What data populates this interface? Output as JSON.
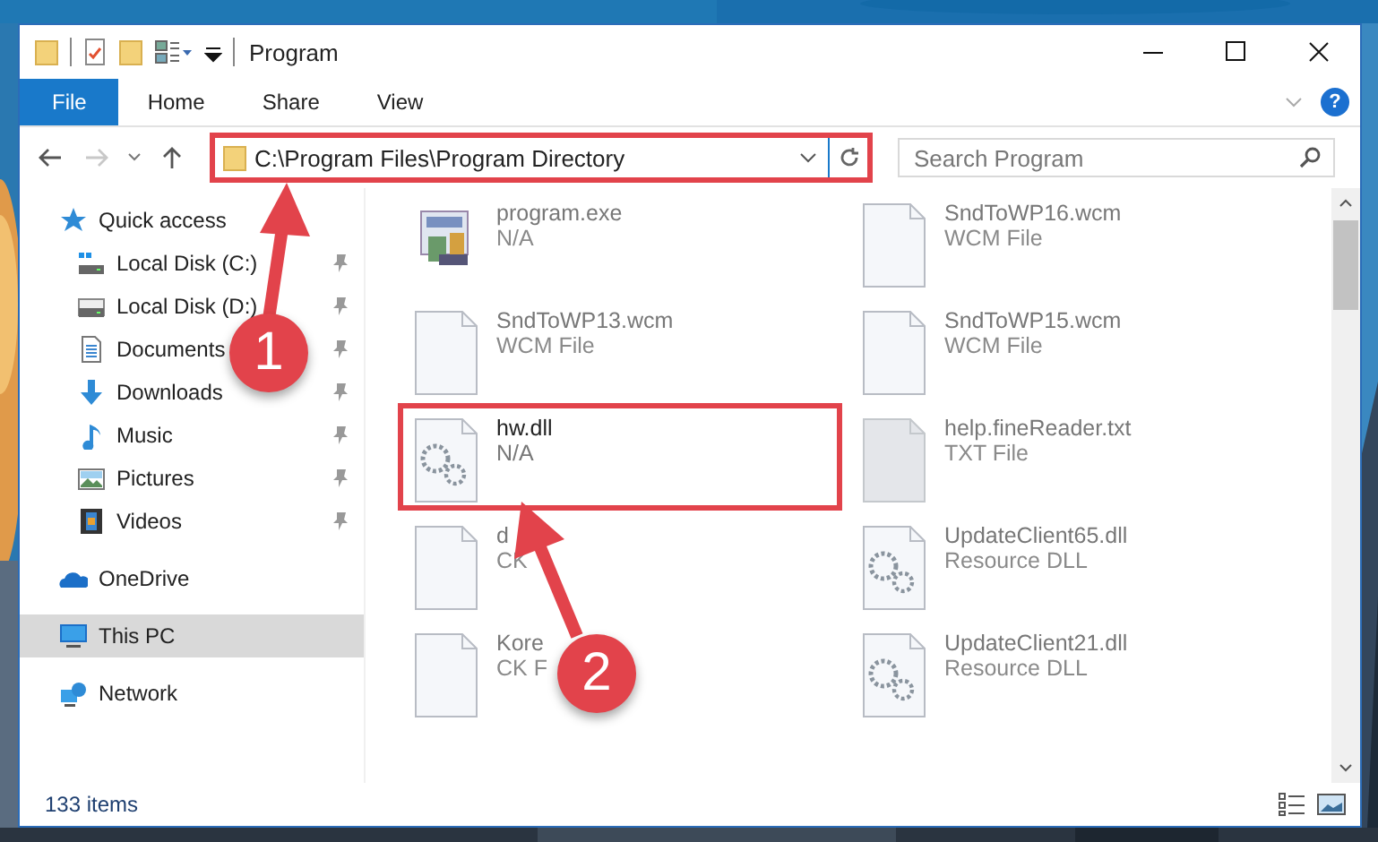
{
  "window": {
    "title": "Program"
  },
  "ribbon": {
    "tabs": [
      {
        "label": "File",
        "selected": true
      },
      {
        "label": "Home",
        "selected": false
      },
      {
        "label": "Share",
        "selected": false
      },
      {
        "label": "View",
        "selected": false
      }
    ],
    "help_label": "?"
  },
  "address_bar": {
    "path": "C:\\Program Files\\Program Directory",
    "highlighted": true
  },
  "search": {
    "placeholder": "Search Program"
  },
  "sidebar": {
    "items": [
      {
        "label": "Quick access",
        "kind": "star",
        "pinned": false,
        "selected": false,
        "group": true
      },
      {
        "label": "Local Disk (C:)",
        "kind": "windrive",
        "pinned": true,
        "selected": false,
        "group": false
      },
      {
        "label": "Local Disk (D:)",
        "kind": "drive",
        "pinned": true,
        "selected": false,
        "group": false
      },
      {
        "label": "Documents",
        "kind": "documents",
        "pinned": true,
        "selected": false,
        "group": false
      },
      {
        "label": "Downloads",
        "kind": "download",
        "pinned": true,
        "selected": false,
        "group": false
      },
      {
        "label": "Music",
        "kind": "music",
        "pinned": true,
        "selected": false,
        "group": false
      },
      {
        "label": "Pictures",
        "kind": "pictures",
        "pinned": true,
        "selected": false,
        "group": false
      },
      {
        "label": "Videos",
        "kind": "videos",
        "pinned": true,
        "selected": false,
        "group": false
      },
      {
        "label": "OneDrive",
        "kind": "cloud",
        "pinned": false,
        "selected": false,
        "group": true
      },
      {
        "label": "This PC",
        "kind": "pc",
        "pinned": false,
        "selected": true,
        "group": true
      },
      {
        "label": "Network",
        "kind": "network",
        "pinned": false,
        "selected": false,
        "group": true
      }
    ]
  },
  "files": [
    {
      "name": "program.exe",
      "type": "N/A",
      "kind": "exe",
      "blurred": true,
      "highlighted": false
    },
    {
      "name": "SndToWP16.wcm",
      "type": "WCM File",
      "kind": "blank",
      "blurred": true,
      "highlighted": false
    },
    {
      "name": "SndToWP13.wcm",
      "type": "WCM File",
      "kind": "blank",
      "blurred": true,
      "highlighted": false
    },
    {
      "name": "SndToWP15.wcm",
      "type": "WCM File",
      "kind": "blank",
      "blurred": true,
      "highlighted": false
    },
    {
      "name": "hw.dll",
      "type": "N/A",
      "kind": "dll",
      "blurred": false,
      "highlighted": true
    },
    {
      "name": "help.fineReader.txt",
      "type": "TXT File",
      "kind": "txt",
      "blurred": true,
      "highlighted": false
    },
    {
      "name": "d",
      "type": "CK",
      "kind": "blank",
      "blurred": true,
      "highlighted": false
    },
    {
      "name": "UpdateClient65.dll",
      "type": "Resource DLL",
      "kind": "dll",
      "blurred": true,
      "highlighted": false
    },
    {
      "name": "Kore",
      "type": "CK F",
      "kind": "blank",
      "blurred": true,
      "highlighted": false
    },
    {
      "name": "UpdateClient21.dll",
      "type": "Resource DLL",
      "kind": "dll",
      "blurred": true,
      "highlighted": false
    }
  ],
  "status_bar": {
    "item_count": "133 items"
  },
  "annotations": [
    {
      "number": "1"
    },
    {
      "number": "2"
    }
  ]
}
